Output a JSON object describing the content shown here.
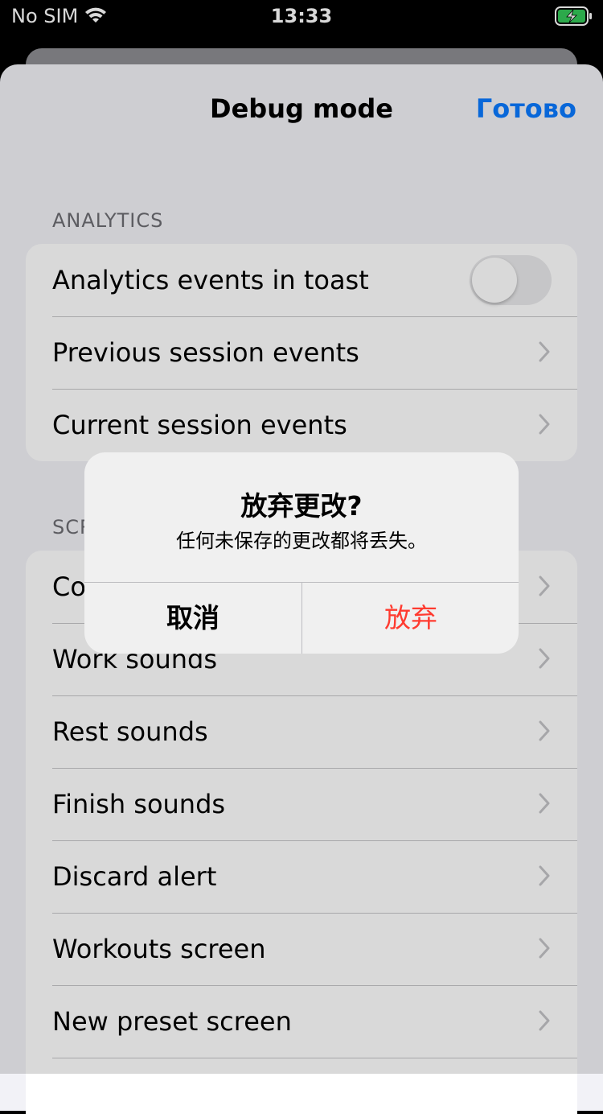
{
  "status_bar": {
    "carrier": "No SIM",
    "time": "13:33",
    "wifi_icon": "wifi-icon",
    "battery_icon": "battery-charging-icon",
    "battery_color": "#34c759"
  },
  "nav": {
    "title": "Debug mode",
    "done_label": "Готово",
    "accent_color": "#0a7aff"
  },
  "sections": [
    {
      "header": "ANALYTICS",
      "rows": [
        {
          "label": "Analytics events in toast",
          "control": "toggle",
          "toggle_on": false
        },
        {
          "label": "Previous session events",
          "control": "chevron"
        },
        {
          "label": "Current session events",
          "control": "chevron"
        }
      ]
    },
    {
      "header": "SCR",
      "rows": [
        {
          "label": "Co",
          "control": "chevron"
        },
        {
          "label": "Work sounds",
          "control": "chevron"
        },
        {
          "label": "Rest sounds",
          "control": "chevron"
        },
        {
          "label": "Finish sounds",
          "control": "chevron"
        },
        {
          "label": "Discard alert",
          "control": "chevron"
        },
        {
          "label": "Workouts screen",
          "control": "chevron"
        },
        {
          "label": "New preset screen",
          "control": "chevron"
        }
      ]
    }
  ],
  "alert": {
    "title": "放弃更改?",
    "message": "任何未保存的更改都将丢失。",
    "cancel_label": "取消",
    "discard_label": "放弃",
    "destructive_color": "#ff3b30"
  }
}
